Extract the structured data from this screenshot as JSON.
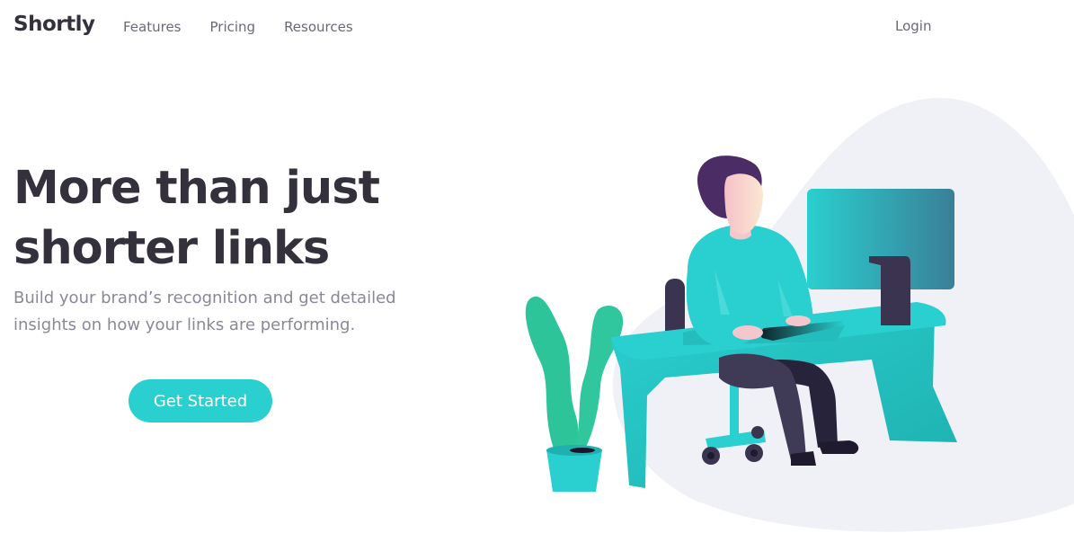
{
  "header": {
    "logo": "Shortly",
    "nav": [
      {
        "label": "Features"
      },
      {
        "label": "Pricing"
      },
      {
        "label": "Resources"
      }
    ],
    "login_label": "Login"
  },
  "hero": {
    "title_line1": "More than just",
    "title_line2": "shorter links",
    "subtitle": "Build your brand’s recognition and get detailed insights on how your links are performing.",
    "cta_label": "Get Started"
  },
  "colors": {
    "primary": "#2acfcf",
    "dark_text": "#34313d",
    "muted_text": "#8a8796",
    "blob_bg": "#f0f1f6"
  },
  "illustration": {
    "icon": "person-working-at-desk-illustration"
  }
}
